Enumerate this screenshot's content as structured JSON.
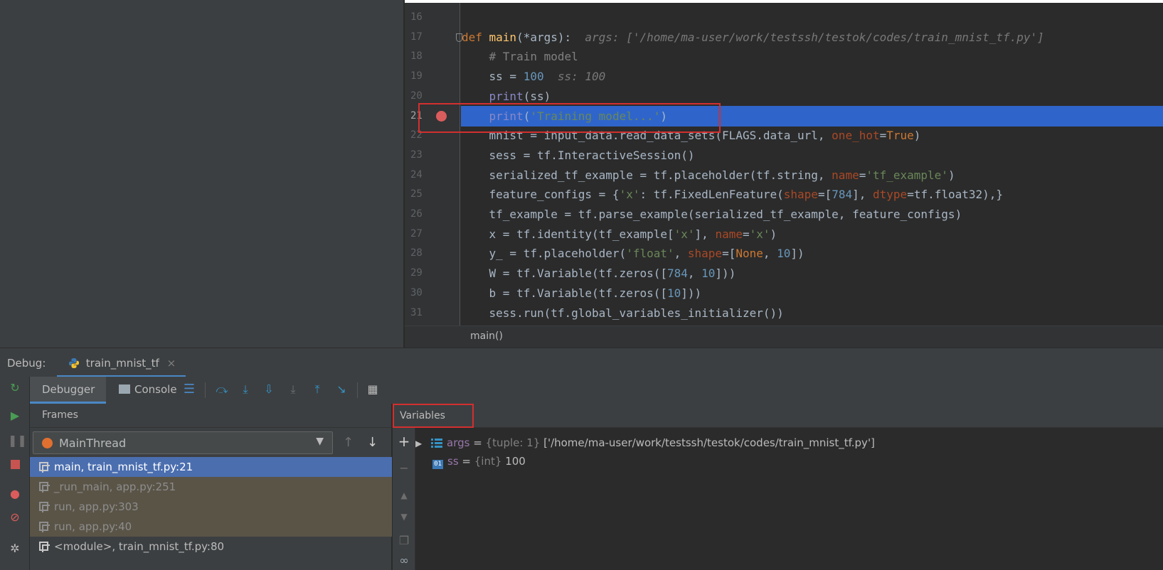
{
  "editor": {
    "lines": [
      {
        "num": "16",
        "tokens": []
      },
      {
        "num": "17",
        "tokens": [
          {
            "t": "def ",
            "c": "kw"
          },
          {
            "t": "main",
            "c": "fn"
          },
          {
            "t": "(*args):  ",
            "c": ""
          },
          {
            "t": "args: ['/home/ma-user/work/testssh/testok/codes/train_mnist_tf.py']",
            "c": "hint"
          }
        ]
      },
      {
        "num": "18",
        "tokens": [
          {
            "t": "    # Train model",
            "c": "cm"
          }
        ]
      },
      {
        "num": "19",
        "tokens": [
          {
            "t": "    ss = ",
            "c": ""
          },
          {
            "t": "100",
            "c": "num"
          },
          {
            "t": "  ",
            "c": ""
          },
          {
            "t": "ss: 100",
            "c": "hint"
          }
        ]
      },
      {
        "num": "20",
        "tokens": [
          {
            "t": "    ",
            "c": ""
          },
          {
            "t": "print",
            "c": "builtin"
          },
          {
            "t": "(ss)",
            "c": ""
          }
        ]
      },
      {
        "num": "21",
        "current": true,
        "breakpoint": true,
        "tokens": [
          {
            "t": "    ",
            "c": ""
          },
          {
            "t": "print",
            "c": "builtin"
          },
          {
            "t": "(",
            "c": ""
          },
          {
            "t": "'Training model...'",
            "c": "str"
          },
          {
            "t": ")",
            "c": ""
          }
        ]
      },
      {
        "num": "22",
        "tokens": [
          {
            "t": "    mnist = input_data.read_data_sets(FLAGS.data_url, ",
            "c": ""
          },
          {
            "t": "one_hot",
            "c": "param"
          },
          {
            "t": "=",
            "c": ""
          },
          {
            "t": "True",
            "c": "kw"
          },
          {
            "t": ")",
            "c": ""
          }
        ]
      },
      {
        "num": "23",
        "tokens": [
          {
            "t": "    sess = tf.InteractiveSession()",
            "c": ""
          }
        ]
      },
      {
        "num": "24",
        "tokens": [
          {
            "t": "    serialized_tf_example = tf.placeholder(tf.string, ",
            "c": ""
          },
          {
            "t": "name",
            "c": "param"
          },
          {
            "t": "=",
            "c": ""
          },
          {
            "t": "'tf_example'",
            "c": "str"
          },
          {
            "t": ")",
            "c": ""
          }
        ]
      },
      {
        "num": "25",
        "tokens": [
          {
            "t": "    feature_configs = {",
            "c": ""
          },
          {
            "t": "'x'",
            "c": "str"
          },
          {
            "t": ": tf.FixedLenFeature(",
            "c": ""
          },
          {
            "t": "shape",
            "c": "param"
          },
          {
            "t": "=[",
            "c": ""
          },
          {
            "t": "784",
            "c": "num"
          },
          {
            "t": "], ",
            "c": ""
          },
          {
            "t": "dtype",
            "c": "param"
          },
          {
            "t": "=tf.float32),}",
            "c": ""
          }
        ]
      },
      {
        "num": "26",
        "tokens": [
          {
            "t": "    tf_example = tf.parse_example(serialized_tf_example, feature_configs)",
            "c": ""
          }
        ]
      },
      {
        "num": "27",
        "tokens": [
          {
            "t": "    x = tf.identity(tf_example[",
            "c": ""
          },
          {
            "t": "'x'",
            "c": "str"
          },
          {
            "t": "], ",
            "c": ""
          },
          {
            "t": "name",
            "c": "param"
          },
          {
            "t": "=",
            "c": ""
          },
          {
            "t": "'x'",
            "c": "str"
          },
          {
            "t": ")",
            "c": ""
          }
        ]
      },
      {
        "num": "28",
        "tokens": [
          {
            "t": "    y_ = tf.placeholder(",
            "c": ""
          },
          {
            "t": "'float'",
            "c": "str"
          },
          {
            "t": ", ",
            "c": ""
          },
          {
            "t": "shape",
            "c": "param"
          },
          {
            "t": "=[",
            "c": ""
          },
          {
            "t": "None",
            "c": "kw"
          },
          {
            "t": ", ",
            "c": ""
          },
          {
            "t": "10",
            "c": "num"
          },
          {
            "t": "])",
            "c": ""
          }
        ]
      },
      {
        "num": "29",
        "tokens": [
          {
            "t": "    W = tf.Variable(tf.zeros([",
            "c": ""
          },
          {
            "t": "784",
            "c": "num"
          },
          {
            "t": ", ",
            "c": ""
          },
          {
            "t": "10",
            "c": "num"
          },
          {
            "t": "]))",
            "c": ""
          }
        ]
      },
      {
        "num": "30",
        "tokens": [
          {
            "t": "    b = tf.Variable(tf.zeros([",
            "c": ""
          },
          {
            "t": "10",
            "c": "num"
          },
          {
            "t": "]))",
            "c": ""
          }
        ]
      },
      {
        "num": "31",
        "tokens": [
          {
            "t": "    sess.run(tf.global_variables_initializer())",
            "c": ""
          }
        ]
      }
    ],
    "breadcrumb": "main()"
  },
  "debug": {
    "label": "Debug:",
    "session_tab": "train_mnist_tf",
    "tabs": {
      "debugger": "Debugger",
      "console": "Console"
    },
    "frames": {
      "title": "Frames",
      "thread": "MainThread",
      "rows": [
        {
          "label": "main, train_mnist_tf.py:21",
          "kind": "selected"
        },
        {
          "label": "_run_main, app.py:251",
          "kind": "lib"
        },
        {
          "label": "run, app.py:303",
          "kind": "lib"
        },
        {
          "label": "run, app.py:40",
          "kind": "lib"
        },
        {
          "label": "<module>, train_mnist_tf.py:80",
          "kind": "normal"
        }
      ]
    },
    "variables": {
      "title": "Variables",
      "rows": [
        {
          "name": "args",
          "type": "{tuple: 1}",
          "value": "['/home/ma-user/work/testssh/testok/codes/train_mnist_tf.py']",
          "icon": "list-icon",
          "expandable": true
        },
        {
          "name": "ss",
          "type": "{int}",
          "value": "100",
          "icon": "int-icon",
          "expandable": false
        }
      ]
    }
  },
  "colors": {
    "accent": "#4a88c7",
    "selection": "#2f65ca",
    "breakpoint": "#db5c5c",
    "highlight_box": "#d32f2f"
  }
}
